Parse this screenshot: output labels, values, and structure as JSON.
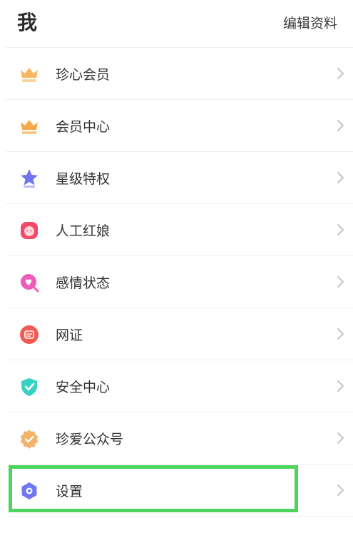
{
  "header": {
    "title": "我",
    "edit_label": "编辑资料"
  },
  "menu": [
    {
      "label": "珍心会员",
      "icon": "crown-icon-peach"
    },
    {
      "label": "会员中心",
      "icon": "crown-icon-orange"
    },
    {
      "label": "星级特权",
      "icon": "star-icon"
    },
    {
      "label": "人工红娘",
      "icon": "matchmaker-icon"
    },
    {
      "label": "感情状态",
      "icon": "heart-search-icon"
    },
    {
      "label": "网证",
      "icon": "id-badge-icon"
    },
    {
      "label": "安全中心",
      "icon": "shield-check-icon"
    },
    {
      "label": "珍爱公众号",
      "icon": "verified-badge-icon"
    },
    {
      "label": "设置",
      "icon": "settings-gear-icon"
    }
  ],
  "colors": {
    "peach": "#f6b75f",
    "orange": "#f6a94a",
    "purple": "#6e73ef",
    "pink": "#f24b6a",
    "magenta": "#f05ab9",
    "red": "#f35a52",
    "teal": "#38d1c2",
    "gold": "#f2b36a",
    "gear": "#6f76f2",
    "highlight": "#4cd45d"
  }
}
